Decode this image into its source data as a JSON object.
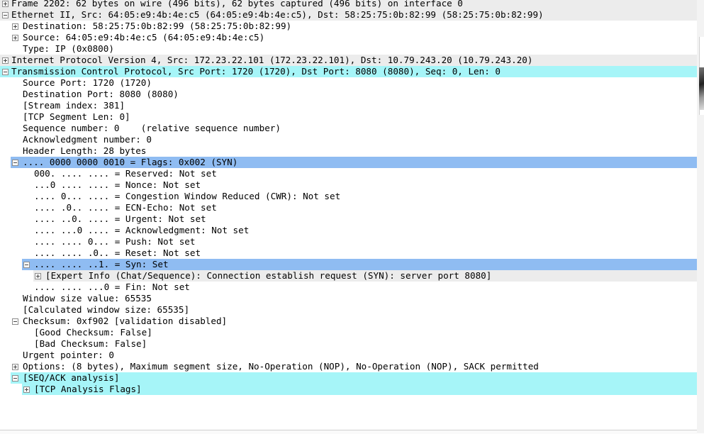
{
  "window": {
    "title": ""
  },
  "tree": [
    {
      "id": "frame",
      "text": "Frame 2202: 62 bytes on wire (496 bits), 62 bytes captured (496 bits) on interface 0",
      "level": 0,
      "toggle": "plus",
      "hl": "section"
    },
    {
      "id": "ethernet",
      "text": "Ethernet II, Src: 64:05:e9:4b:4e:c5 (64:05:e9:4b:4e:c5), Dst: 58:25:75:0b:82:99 (58:25:75:0b:82:99)",
      "level": 0,
      "toggle": "minus",
      "hl": "section"
    },
    {
      "id": "eth-dst",
      "text": "Destination: 58:25:75:0b:82:99 (58:25:75:0b:82:99)",
      "level": 1,
      "toggle": "plus",
      "hl": "none"
    },
    {
      "id": "eth-src",
      "text": "Source: 64:05:e9:4b:4e:c5 (64:05:e9:4b:4e:c5)",
      "level": 1,
      "toggle": "plus",
      "hl": "none"
    },
    {
      "id": "eth-type",
      "text": "Type: IP (0x0800)",
      "level": 1,
      "toggle": "none",
      "hl": "none"
    },
    {
      "id": "ip",
      "text": "Internet Protocol Version 4, Src: 172.23.22.101 (172.23.22.101), Dst: 10.79.243.20 (10.79.243.20)",
      "level": 0,
      "toggle": "plus",
      "hl": "section"
    },
    {
      "id": "tcp",
      "text": "Transmission Control Protocol, Src Port: 1720 (1720), Dst Port: 8080 (8080), Seq: 0, Len: 0",
      "level": 0,
      "toggle": "minus",
      "hl": "cyan"
    },
    {
      "id": "src-port",
      "text": "Source Port: 1720 (1720)",
      "level": 1,
      "toggle": "none",
      "hl": "none"
    },
    {
      "id": "dst-port",
      "text": "Destination Port: 8080 (8080)",
      "level": 1,
      "toggle": "none",
      "hl": "none"
    },
    {
      "id": "stream-index",
      "text": "[Stream index: 381]",
      "level": 1,
      "toggle": "none",
      "hl": "none"
    },
    {
      "id": "seg-len",
      "text": "[TCP Segment Len: 0]",
      "level": 1,
      "toggle": "none",
      "hl": "none"
    },
    {
      "id": "seq-num",
      "text": "Sequence number: 0    (relative sequence number)",
      "level": 1,
      "toggle": "none",
      "hl": "none"
    },
    {
      "id": "ack-num",
      "text": "Acknowledgment number: 0",
      "level": 1,
      "toggle": "none",
      "hl": "none"
    },
    {
      "id": "hdr-len",
      "text": "Header Length: 28 bytes",
      "level": 1,
      "toggle": "none",
      "hl": "none"
    },
    {
      "id": "flags",
      "text": ".... 0000 0000 0010 = Flags: 0x002 (SYN)",
      "level": 1,
      "toggle": "minus",
      "hl": "blue"
    },
    {
      "id": "flag-reserved",
      "text": "000. .... .... = Reserved: Not set",
      "level": 2,
      "toggle": "none",
      "hl": "none"
    },
    {
      "id": "flag-nonce",
      "text": "...0 .... .... = Nonce: Not set",
      "level": 2,
      "toggle": "none",
      "hl": "none"
    },
    {
      "id": "flag-cwr",
      "text": ".... 0... .... = Congestion Window Reduced (CWR): Not set",
      "level": 2,
      "toggle": "none",
      "hl": "none"
    },
    {
      "id": "flag-ecn",
      "text": ".... .0.. .... = ECN-Echo: Not set",
      "level": 2,
      "toggle": "none",
      "hl": "none"
    },
    {
      "id": "flag-urg",
      "text": ".... ..0. .... = Urgent: Not set",
      "level": 2,
      "toggle": "none",
      "hl": "none"
    },
    {
      "id": "flag-ack",
      "text": ".... ...0 .... = Acknowledgment: Not set",
      "level": 2,
      "toggle": "none",
      "hl": "none"
    },
    {
      "id": "flag-push",
      "text": ".... .... 0... = Push: Not set",
      "level": 2,
      "toggle": "none",
      "hl": "none"
    },
    {
      "id": "flag-reset",
      "text": ".... .... .0.. = Reset: Not set",
      "level": 2,
      "toggle": "none",
      "hl": "none"
    },
    {
      "id": "flag-syn",
      "text": ".... .... ..1. = Syn: Set",
      "level": 2,
      "toggle": "minus",
      "hl": "blue"
    },
    {
      "id": "expert-info",
      "text": "[Expert Info (Chat/Sequence): Connection establish request (SYN): server port 8080]",
      "level": 3,
      "toggle": "plus",
      "hl": "section"
    },
    {
      "id": "flag-fin",
      "text": ".... .... ...0 = Fin: Not set",
      "level": 2,
      "toggle": "none",
      "hl": "none"
    },
    {
      "id": "win-size",
      "text": "Window size value: 65535",
      "level": 1,
      "toggle": "none",
      "hl": "none"
    },
    {
      "id": "calc-win",
      "text": "[Calculated window size: 65535]",
      "level": 1,
      "toggle": "none",
      "hl": "none"
    },
    {
      "id": "checksum",
      "text": "Checksum: 0xf902 [validation disabled]",
      "level": 1,
      "toggle": "minus",
      "hl": "none"
    },
    {
      "id": "good-checksum",
      "text": "[Good Checksum: False]",
      "level": 2,
      "toggle": "none",
      "hl": "none"
    },
    {
      "id": "bad-checksum",
      "text": "[Bad Checksum: False]",
      "level": 2,
      "toggle": "none",
      "hl": "none"
    },
    {
      "id": "urgent-ptr",
      "text": "Urgent pointer: 0",
      "level": 1,
      "toggle": "none",
      "hl": "none"
    },
    {
      "id": "options",
      "text": "Options: (8 bytes), Maximum segment size, No-Operation (NOP), No-Operation (NOP), SACK permitted",
      "level": 1,
      "toggle": "plus",
      "hl": "none"
    },
    {
      "id": "seq-ack",
      "text": "[SEQ/ACK analysis]",
      "level": 1,
      "toggle": "minus",
      "hl": "cyan"
    },
    {
      "id": "tcp-analysis-flags",
      "text": "[TCP Analysis Flags]",
      "level": 2,
      "toggle": "plus",
      "hl": "cyan"
    }
  ],
  "colors": {
    "section": "#ececec",
    "cyan": "#a6f5f8",
    "blue": "#8fbcf2"
  }
}
